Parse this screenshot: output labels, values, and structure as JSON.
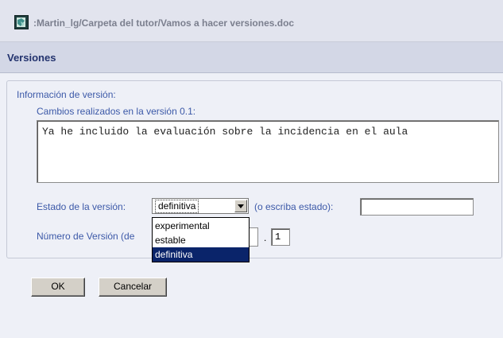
{
  "window": {
    "title": ":Martin_lg/Carpeta del tutor/Vamos a hacer versiones.doc",
    "icon": "document-icon"
  },
  "section": {
    "title": "Versiones"
  },
  "form": {
    "info_label": "Información de versión:",
    "changes_label": "Cambios realizados en la versión 0.1:",
    "changes_text": "Ya he incluido la evaluación sobre la incidencia en el aula",
    "status_label": "Estado de la versión:",
    "status_selected": "definitiva",
    "status_options": [
      "experimental",
      "estable",
      "definitiva"
    ],
    "status_write_label": "(o escriba estado):",
    "status_write_value": "",
    "version_label": "Número de Versión (de",
    "version_dot": ".",
    "version_minor": "1"
  },
  "buttons": {
    "ok": "OK",
    "cancel": "Cancelar"
  }
}
